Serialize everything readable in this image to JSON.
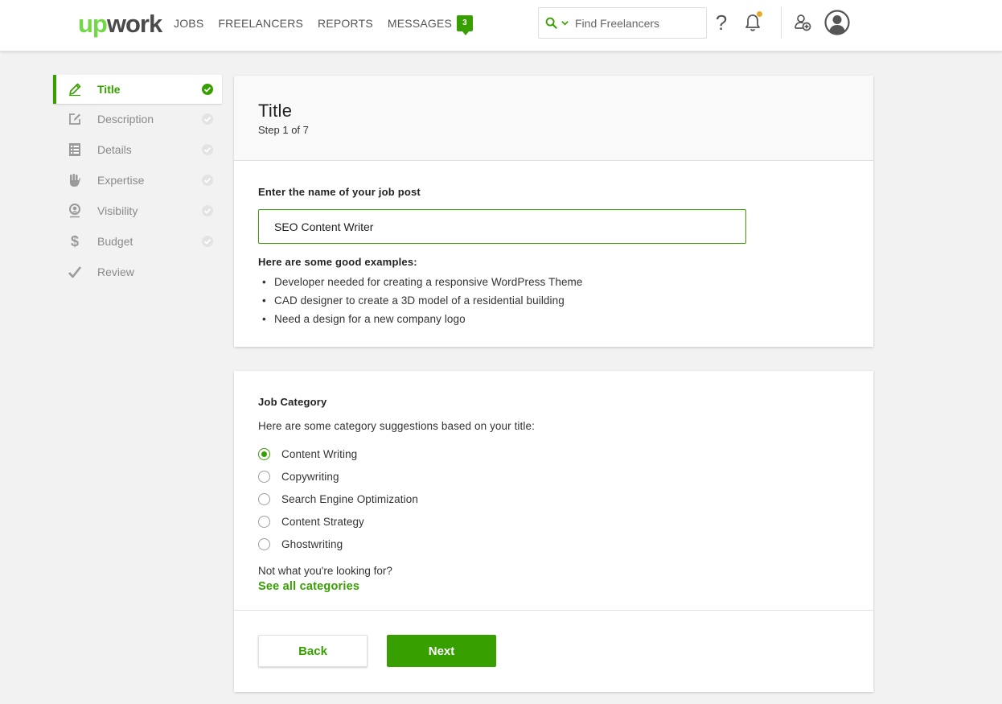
{
  "header": {
    "logo_up": "up",
    "logo_work": "work",
    "nav": [
      {
        "label": "JOBS"
      },
      {
        "label": "FREELANCERS"
      },
      {
        "label": "REPORTS"
      },
      {
        "label": "MESSAGES"
      }
    ],
    "messages_count": "3",
    "search_placeholder": "Find Freelancers",
    "help_glyph": "?",
    "notification_dot_color": "#e8a82a"
  },
  "sidebar": {
    "items": [
      {
        "label": "Title",
        "icon": "pencil-icon",
        "active": true
      },
      {
        "label": "Description",
        "icon": "edit-icon"
      },
      {
        "label": "Details",
        "icon": "list-icon"
      },
      {
        "label": "Expertise",
        "icon": "hand-icon"
      },
      {
        "label": "Visibility",
        "icon": "visibility-icon"
      },
      {
        "label": "Budget",
        "icon": "dollar-icon"
      },
      {
        "label": "Review",
        "icon": "checkmark-icon"
      }
    ]
  },
  "title_card": {
    "title": "Title",
    "step": "Step 1 of 7",
    "input_label": "Enter the name of your job post",
    "input_value": "SEO Content Writer",
    "examples_heading": "Here are some good examples:",
    "examples": [
      "Developer needed for creating a responsive WordPress Theme",
      "CAD designer to create a 3D model of a residential building",
      "Need a design for a new company logo"
    ]
  },
  "category_card": {
    "heading": "Job Category",
    "suggestion_text": "Here are some category suggestions based on your title:",
    "options": [
      {
        "label": "Content Writing",
        "checked": true
      },
      {
        "label": "Copywriting",
        "checked": false
      },
      {
        "label": "Search Engine Optimization",
        "checked": false
      },
      {
        "label": "Content Strategy",
        "checked": false
      },
      {
        "label": "Ghostwriting",
        "checked": false
      }
    ],
    "not_what": "Not what you're looking for?",
    "see_all": "See all categories"
  },
  "actions": {
    "back": "Back",
    "next": "Next"
  },
  "colors": {
    "brand_green": "#37a000",
    "logo_green": "#6fda44"
  }
}
